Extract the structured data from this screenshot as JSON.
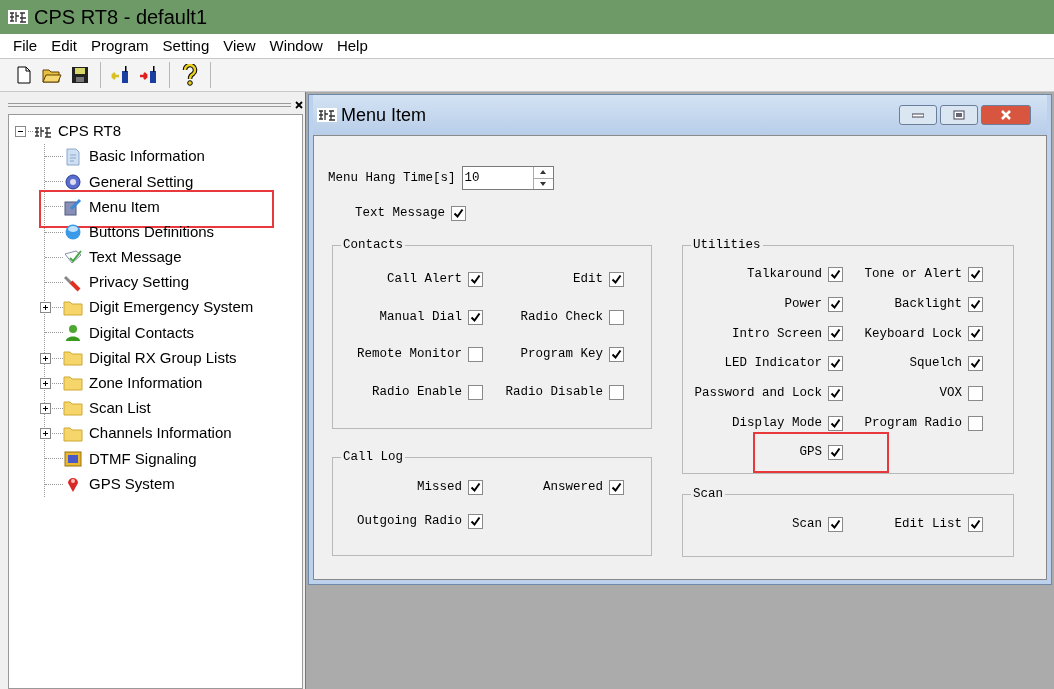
{
  "window": {
    "title": "CPS RT8 - default1"
  },
  "menu": [
    "File",
    "Edit",
    "Program",
    "Setting",
    "View",
    "Window",
    "Help"
  ],
  "tree": {
    "label": "CPS RT8",
    "expanded": true,
    "children": [
      {
        "label": "Basic Information",
        "kind": "document",
        "highlighted": false
      },
      {
        "label": "General Setting",
        "kind": "gear",
        "highlighted": false
      },
      {
        "label": "Menu Item",
        "kind": "edit",
        "highlighted": true
      },
      {
        "label": "Buttons Definitions",
        "kind": "button",
        "highlighted": false
      },
      {
        "label": "Text Message",
        "kind": "message",
        "highlighted": false
      },
      {
        "label": "Privacy Setting",
        "kind": "privacy",
        "highlighted": false
      },
      {
        "label": "Digit Emergency System",
        "kind": "folder",
        "highlighted": false
      },
      {
        "label": "Digital Contacts",
        "kind": "contact",
        "highlighted": false
      },
      {
        "label": "Digital RX Group Lists",
        "kind": "folder",
        "highlighted": false
      },
      {
        "label": "Zone Information",
        "kind": "folder",
        "highlighted": false
      },
      {
        "label": "Scan List",
        "kind": "folder",
        "highlighted": false
      },
      {
        "label": "Channels Information",
        "kind": "folder",
        "highlighted": false
      },
      {
        "label": "DTMF Signaling",
        "kind": "dtmf",
        "highlighted": false
      },
      {
        "label": "GPS System",
        "kind": "pin",
        "highlighted": false
      }
    ]
  },
  "child_window": {
    "title": "Menu Item",
    "menu_hang_time": {
      "label": "Menu Hang Time[s]",
      "value": "10"
    },
    "text_message": {
      "label": "Text Message",
      "checked": true
    },
    "left_groups": [
      {
        "title": "Contacts",
        "items": [
          {
            "label": "Call Alert",
            "checked": true,
            "highlighted": false
          },
          {
            "label": "Edit",
            "checked": true,
            "highlighted": false
          },
          {
            "label": "Manual Dial",
            "checked": true,
            "highlighted": false
          },
          {
            "label": "Radio Check",
            "checked": false,
            "highlighted": false
          },
          {
            "label": "Remote Monitor",
            "checked": false,
            "highlighted": false
          },
          {
            "label": "Program Key",
            "checked": true,
            "highlighted": false
          },
          {
            "label": "Radio Enable",
            "checked": false,
            "highlighted": false
          },
          {
            "label": "Radio Disable",
            "checked": false,
            "highlighted": false
          }
        ]
      },
      {
        "title": "Call Log",
        "items": [
          {
            "label": "Missed",
            "checked": true,
            "highlighted": false
          },
          {
            "label": "Answered",
            "checked": true,
            "highlighted": false
          },
          {
            "label": "Outgoing Radio",
            "checked": true,
            "highlighted": false
          }
        ]
      }
    ],
    "right_groups": [
      {
        "title": "Utilities",
        "items": [
          {
            "label": "Talkaround",
            "checked": true,
            "highlighted": false
          },
          {
            "label": "Tone or Alert",
            "checked": true,
            "highlighted": false
          },
          {
            "label": "Power",
            "checked": true,
            "highlighted": false
          },
          {
            "label": "Backlight",
            "checked": true,
            "highlighted": false
          },
          {
            "label": "Intro Screen",
            "checked": true,
            "highlighted": false
          },
          {
            "label": "Keyboard Lock",
            "checked": true,
            "highlighted": false
          },
          {
            "label": "LED Indicator",
            "checked": true,
            "highlighted": false
          },
          {
            "label": "Squelch",
            "checked": true,
            "highlighted": false
          },
          {
            "label": "Password and Lock",
            "checked": true,
            "highlighted": false
          },
          {
            "label": "VOX",
            "checked": false,
            "highlighted": false
          },
          {
            "label": "Display Mode",
            "checked": true,
            "highlighted": false
          },
          {
            "label": "Program Radio",
            "checked": false,
            "highlighted": false
          },
          {
            "label": "GPS",
            "checked": true,
            "highlighted": true
          }
        ]
      },
      {
        "title": "Scan",
        "items": [
          {
            "label": "Scan",
            "checked": true,
            "highlighted": false
          },
          {
            "label": "Edit List",
            "checked": true,
            "highlighted": false
          }
        ]
      }
    ]
  }
}
